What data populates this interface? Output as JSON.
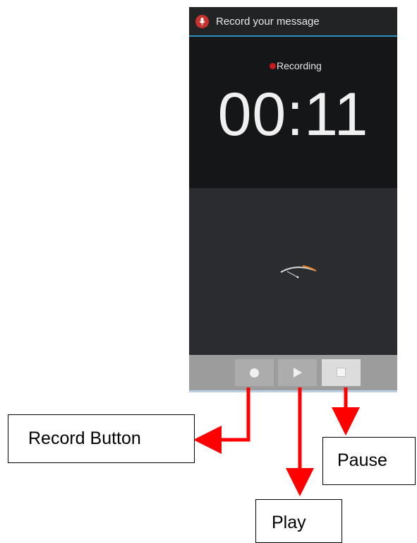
{
  "app": {
    "title": "Record your message",
    "icon": "microphone-icon",
    "accent_color": "#2f8fc0"
  },
  "recorder": {
    "status": "Recording",
    "status_color": "#c71a1a",
    "elapsed": "00:11",
    "level_icon": "vu-meter-icon"
  },
  "controls": {
    "record": "record-icon",
    "play": "play-icon",
    "stop": "stop-icon"
  },
  "annotations": {
    "record": "Record Button",
    "play": "Play",
    "pause": "Pause",
    "arrow_color": "#ff0000"
  }
}
